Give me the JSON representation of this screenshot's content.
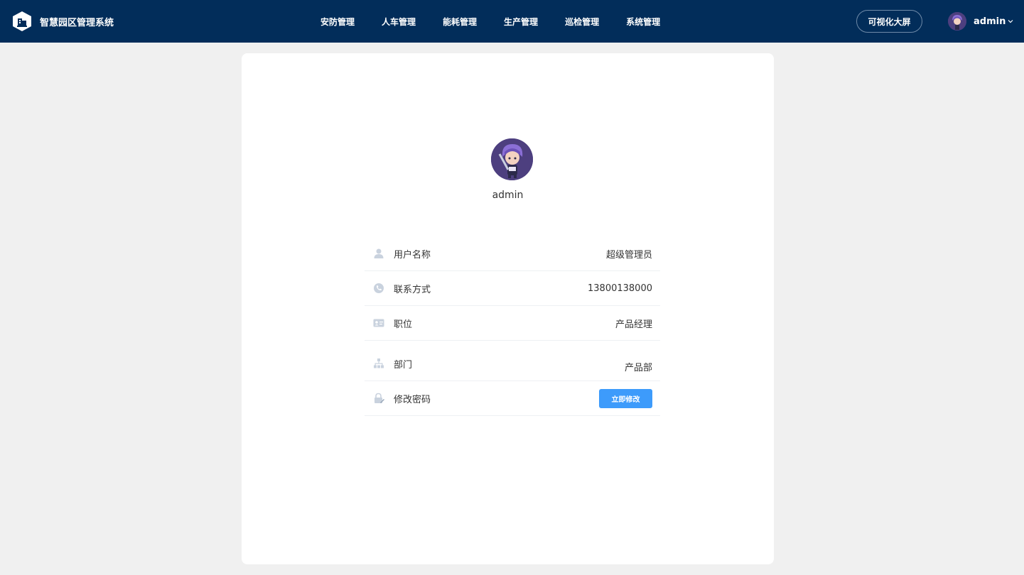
{
  "header": {
    "app_title": "智慧园区管理系统",
    "nav": [
      {
        "label": "安防管理"
      },
      {
        "label": "人车管理"
      },
      {
        "label": "能耗管理"
      },
      {
        "label": "生产管理"
      },
      {
        "label": "巡检管理"
      },
      {
        "label": "系统管理"
      }
    ],
    "screen_button": "可视化大屏",
    "user_name": "admin"
  },
  "profile": {
    "name": "admin",
    "rows": [
      {
        "label": "用户名称",
        "value": "超级管理员",
        "icon": "user-icon"
      },
      {
        "label": "联系方式",
        "value": "13800138000",
        "icon": "phone-icon"
      },
      {
        "label": "职位",
        "value": "产品经理",
        "icon": "id-card-icon"
      },
      {
        "label": "部门",
        "value": "产品部",
        "icon": "org-chart-icon"
      },
      {
        "label": "修改密码",
        "icon": "lock-edit-icon"
      }
    ],
    "change_password_button": "立即修改"
  },
  "colors": {
    "header_bg": "#022d5a",
    "page_bg": "#f0f0f0",
    "accent": "#3d9bfb",
    "icon_gray": "#c9d2de"
  }
}
